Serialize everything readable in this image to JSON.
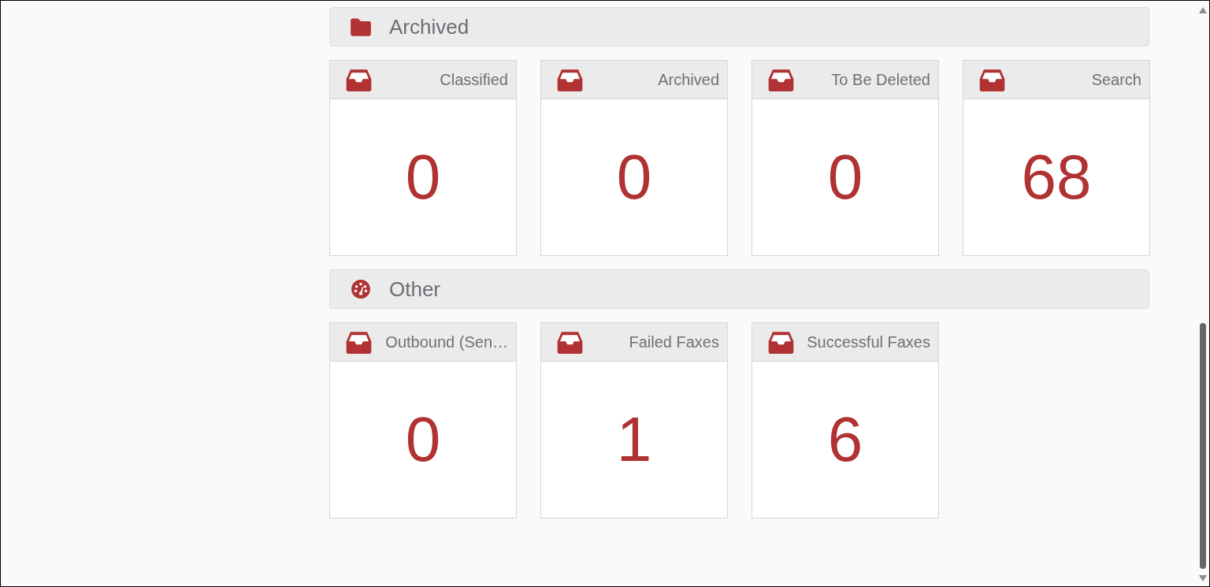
{
  "sections": [
    {
      "title": "Archived",
      "kind": "folder",
      "cards": [
        {
          "label": "Classified",
          "count": "0"
        },
        {
          "label": "Archived",
          "count": "0"
        },
        {
          "label": "To Be Deleted",
          "count": "0"
        },
        {
          "label": "Search",
          "count": "68"
        }
      ]
    },
    {
      "title": "Other",
      "kind": "gauge",
      "cards": [
        {
          "label": "Outbound (Sen…",
          "count": "0"
        },
        {
          "label": "Failed Faxes",
          "count": "1"
        },
        {
          "label": "Successful Faxes",
          "count": "6"
        }
      ]
    }
  ]
}
